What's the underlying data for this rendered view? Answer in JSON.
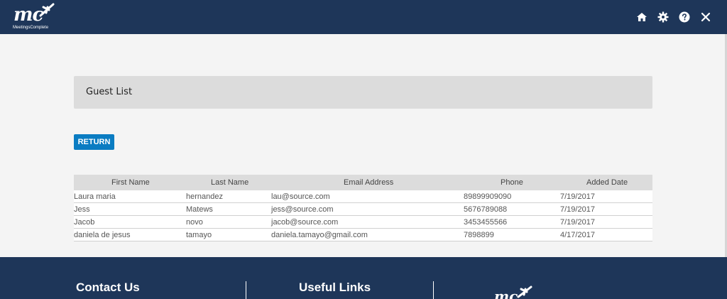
{
  "header": {
    "logo_text": "mc",
    "brand_name": "MeetingsComplete",
    "icons": [
      "home-icon",
      "gear-icon",
      "help-icon",
      "close-icon"
    ]
  },
  "panel": {
    "title": "Guest List"
  },
  "actions": {
    "return_label": "RETURN"
  },
  "table": {
    "columns": [
      "First Name",
      "Last Name",
      "Email Address",
      "Phone",
      "Added Date"
    ],
    "rows": [
      [
        "Laura maria",
        "hernandez",
        "lau@source.com",
        "89899909090",
        "7/19/2017"
      ],
      [
        "Jess",
        "Matews",
        "jess@source.com",
        "5676789088",
        "7/19/2017"
      ],
      [
        "Jacob",
        "novo",
        "jacob@source.com",
        "3453455566",
        "7/19/2017"
      ],
      [
        "daniela de jesus",
        "tamayo",
        "daniela.tamayo@gmail.com",
        "7898899",
        "4/17/2017"
      ]
    ]
  },
  "footer": {
    "contact_title": "Contact Us",
    "links_title": "Useful Links"
  },
  "colors": {
    "navy": "#1e3659",
    "accent": "#0a7cc2"
  }
}
